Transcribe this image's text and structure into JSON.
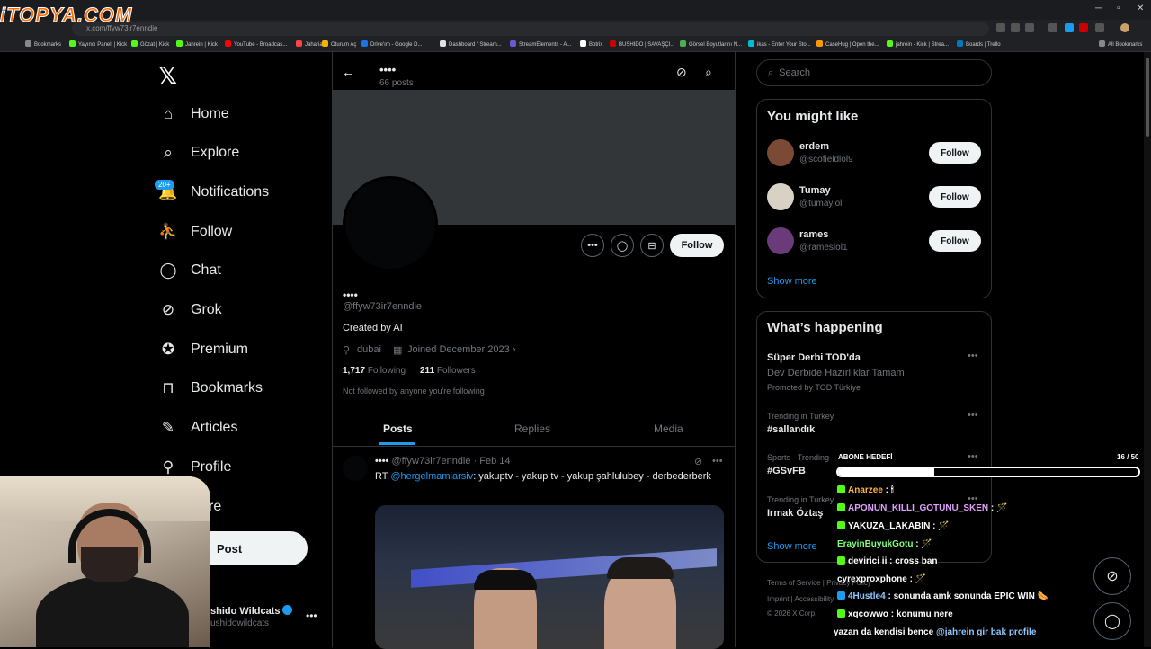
{
  "watermark": {
    "text": "iTOPYA.COM"
  },
  "browser": {
    "url": "x.com/ffyw73ir7enndie",
    "bookmarks": [
      {
        "label": "Bookmarks",
        "color": "#888888"
      },
      {
        "label": "Yayıncı Paneli | Kick",
        "color": "#53fc18"
      },
      {
        "label": "Gözat | Kick",
        "color": "#53fc18"
      },
      {
        "label": "Jahrein | Kick",
        "color": "#53fc18"
      },
      {
        "label": "YouTube - Broadcas...",
        "color": "#ff0000"
      },
      {
        "label": "Jaharia",
        "color": "#ff4444"
      },
      {
        "label": "Oturum Aç",
        "color": "#f4b400"
      },
      {
        "label": "Drive'ım - Google D...",
        "color": "#1a73e8"
      },
      {
        "label": "Dashboard / Stream...",
        "color": "#e1e1e1"
      },
      {
        "label": "StreamElements - A...",
        "color": "#6a5acd"
      },
      {
        "label": "Botrix",
        "color": "#ffffff"
      },
      {
        "label": "BUSHIDO | SAVAŞÇI...",
        "color": "#cc0000"
      },
      {
        "label": "Görsel Boyutlarını N...",
        "color": "#4caf50"
      },
      {
        "label": "ikas - Enter Your Sto...",
        "color": "#00bcd4"
      },
      {
        "label": "CaseHug | Open the...",
        "color": "#ff9800"
      },
      {
        "label": "jahrein - Kick | Strea...",
        "color": "#53fc18"
      },
      {
        "label": "Boards | Trello",
        "color": "#0079bf"
      }
    ],
    "all_bookmarks": "All Bookmarks"
  },
  "sidebar": {
    "items": [
      {
        "label": "Home",
        "icon": "home-icon",
        "glyph": "⌂"
      },
      {
        "label": "Explore",
        "icon": "search-icon",
        "glyph": "⌕"
      },
      {
        "label": "Notifications",
        "icon": "bell-icon",
        "glyph": "🔔"
      },
      {
        "label": "Follow",
        "icon": "person-add-icon",
        "glyph": "⛹"
      },
      {
        "label": "Chat",
        "icon": "chat-icon",
        "glyph": "◯"
      },
      {
        "label": "Grok",
        "icon": "grok-icon",
        "glyph": "⊘"
      },
      {
        "label": "Premium",
        "icon": "verified-icon",
        "glyph": "✪"
      },
      {
        "label": "Bookmarks",
        "icon": "bookmark-icon",
        "glyph": "⊓"
      },
      {
        "label": "Articles",
        "icon": "article-icon",
        "glyph": "✎"
      },
      {
        "label": "Profile",
        "icon": "person-icon",
        "glyph": "⚲"
      },
      {
        "label": "re",
        "icon": "more-icon",
        "glyph": ""
      }
    ],
    "notif_badge": "20+",
    "post_label": "Post",
    "account_name": "shido Wildcats",
    "account_handle": "ushidowildcats",
    "more": "•••"
  },
  "profile": {
    "header_name": "••••",
    "post_count": "66 posts",
    "name": "••••",
    "handle": "@ffyw73ir7enndie",
    "bio": "Created by AI",
    "location": "dubai",
    "joined": "Joined December 2023",
    "following_count": "1,717",
    "following_label": "Following",
    "followers_count": "211",
    "followers_label": "Followers",
    "not_followed": "Not followed by anyone you're following",
    "follow_label": "Follow",
    "tabs": [
      "Posts",
      "Replies",
      "Media"
    ]
  },
  "tweet": {
    "name": "••••",
    "handle_date": "@ffyw73ir7enndie · Feb 14",
    "rt": "RT ",
    "mention": "@hergelmamiarsiv",
    "text": ": yakuptv - yakup tv - yakup şahlulubey - derbederberk"
  },
  "right": {
    "search_placeholder": "Search",
    "wtf_title": "You might like",
    "wtf": [
      {
        "name": "erdem",
        "handle": "@scofieldlol9",
        "btn": "Follow",
        "color": "#7a4a36"
      },
      {
        "name": "Tumay",
        "handle": "@tumaylol",
        "btn": "Follow",
        "color": "#d8d2c4"
      },
      {
        "name": "rames",
        "handle": "@rameslol1",
        "btn": "Follow",
        "color": "#6b3a7a"
      }
    ],
    "show_more": "Show more",
    "trends_title": "What’s happening",
    "trends": [
      {
        "ctx": "",
        "title": "Süper Derbi TOD'da",
        "sub": "Dev Derbide Hazırlıklar Tamam",
        "promo": "Promoted by TOD Türkiye"
      },
      {
        "ctx": "Trending in Turkey",
        "title": "#sallandık",
        "sub": "",
        "promo": ""
      },
      {
        "ctx": "Sports · Trending",
        "title": "#GSvFB",
        "sub": "",
        "promo": ""
      },
      {
        "ctx": "Trending in Turkey",
        "title": "Irmak Öztaş",
        "sub": "",
        "promo": ""
      }
    ],
    "trends_more": "Show more",
    "footer": [
      "Terms of Service",
      "Privacy Policy",
      "Imprint",
      "Accessibility",
      "© 2026 X Corp."
    ]
  },
  "overlay": {
    "sub_label": "ABONE HEDEFİ",
    "sub_count": "16 / 50",
    "sub_progress": 0.32,
    "chat": [
      {
        "user": "Anarzee",
        "msg": " : 🕯",
        "color": "#ffb347",
        "badge": "#53fc18"
      },
      {
        "user": "APONUN_KILLI_GOTUNU_SKEN",
        "msg": " : 🪄",
        "color": "#e0a0ff",
        "badge": "#53fc18"
      },
      {
        "user": "YAKUZA_LAKABIN",
        "msg": " : 🪄",
        "color": "#ffffff",
        "badge": "#53fc18"
      },
      {
        "user": "ErayinBuyukGotu",
        "msg": " : 🪄",
        "color": "#7dff7d",
        "badge": ""
      },
      {
        "user": "devirici ii",
        "msg": " : cross ban",
        "color": "#ffffff",
        "badge": "#53fc18"
      },
      {
        "user": "cyrexproxphone",
        "msg": " : 🪄",
        "color": "#ffffff",
        "badge": ""
      },
      {
        "user": "4Hustle4",
        "msg": " : sonunda amk sonunda EPIC WIN 🌭",
        "color": "#8fc8ff",
        "badge": "#1d9bf0"
      },
      {
        "user": "xqcowwo",
        "msg": " : konumu nere",
        "color": "#ffffff",
        "badge": "#53fc18"
      },
      {
        "user": "yazan da kendisi bence ",
        "msg": "@jahrein gir bak profile",
        "color": "#ffffff",
        "badge": ""
      }
    ]
  }
}
